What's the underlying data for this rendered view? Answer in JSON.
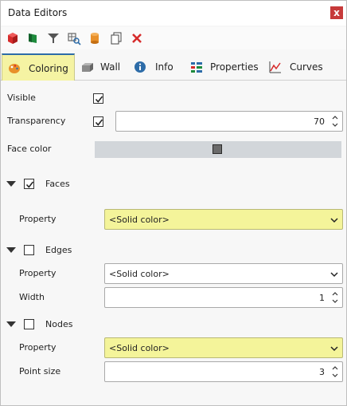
{
  "window": {
    "title": "Data Editors",
    "close_label": "x"
  },
  "toolbar": {
    "buttons": [
      "cube-icon",
      "flag-icon",
      "filter-icon",
      "search-grid-icon",
      "cylinder-icon",
      "copy-icon",
      "delete-icon"
    ]
  },
  "tabs": [
    {
      "label": "Coloring",
      "active": true,
      "icon": "palette-icon"
    },
    {
      "label": "Wall",
      "active": false,
      "icon": "wall-icon"
    },
    {
      "label": "Info",
      "active": false,
      "icon": "info-icon"
    },
    {
      "label": "Properties",
      "active": false,
      "icon": "properties-icon"
    },
    {
      "label": "Curves",
      "active": false,
      "icon": "curves-icon"
    }
  ],
  "coloring": {
    "visible_label": "Visible",
    "visible_checked": true,
    "transparency_label": "Transparency",
    "transparency_checked": true,
    "transparency_value": "70",
    "face_color_label": "Face color",
    "face_color": "#6b6b6b"
  },
  "faces": {
    "label": "Faces",
    "checked": true,
    "property_label": "Property",
    "property_value": "<Solid color>"
  },
  "edges": {
    "label": "Edges",
    "checked": false,
    "property_label": "Property",
    "property_value": "<Solid color>",
    "width_label": "Width",
    "width_value": "1"
  },
  "nodes": {
    "label": "Nodes",
    "checked": false,
    "property_label": "Property",
    "property_value": "<Solid color>",
    "point_size_label": "Point size",
    "point_size_value": "3"
  },
  "colors": {
    "accent": "#2d6ca8",
    "highlight": "#f4f49a",
    "tab_active": "#f5f3a3"
  }
}
